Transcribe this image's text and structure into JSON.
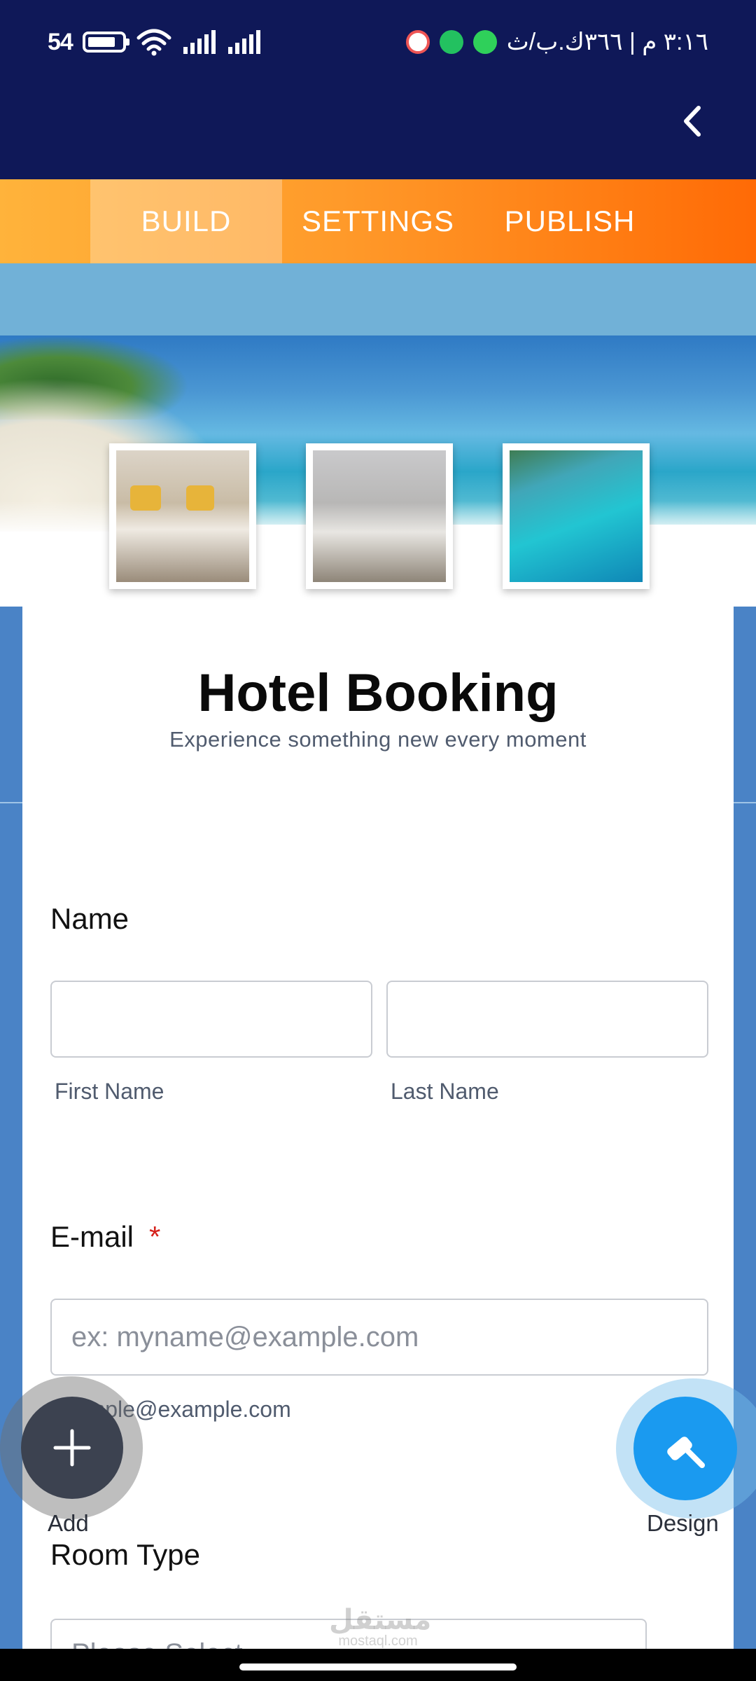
{
  "status_bar": {
    "battery_text": "54",
    "time_text": "٣:١٦ م | ٣٦٦ك.ب/ث"
  },
  "tabs": [
    {
      "label": "BUILD",
      "active": true
    },
    {
      "label": "SETTINGS",
      "active": false
    },
    {
      "label": "PUBLISH",
      "active": false
    }
  ],
  "form": {
    "title": "Hotel Booking",
    "subtitle": "Experience something new every moment",
    "name_label": "Name",
    "first_name_value": "",
    "last_name_value": "",
    "first_name_sublabel": "First Name",
    "last_name_sublabel": "Last Name",
    "email_label": "E-mail",
    "email_required_mark": "*",
    "email_placeholder": "ex: myname@example.com",
    "email_hint": "example@example.com",
    "room_type_label": "Room Type",
    "room_type_select_text": "Please Select"
  },
  "fabs": {
    "add_label": "Add",
    "design_label": "Design"
  },
  "watermark": {
    "arabic": "مستقل",
    "latin": "mostaql.com"
  },
  "colors": {
    "header_bg": "#0f1858",
    "tab_gradient_start": "#ffb33b",
    "tab_gradient_end": "#ff6a06",
    "accent_blue": "#1a9af0",
    "required": "#d6221c"
  }
}
